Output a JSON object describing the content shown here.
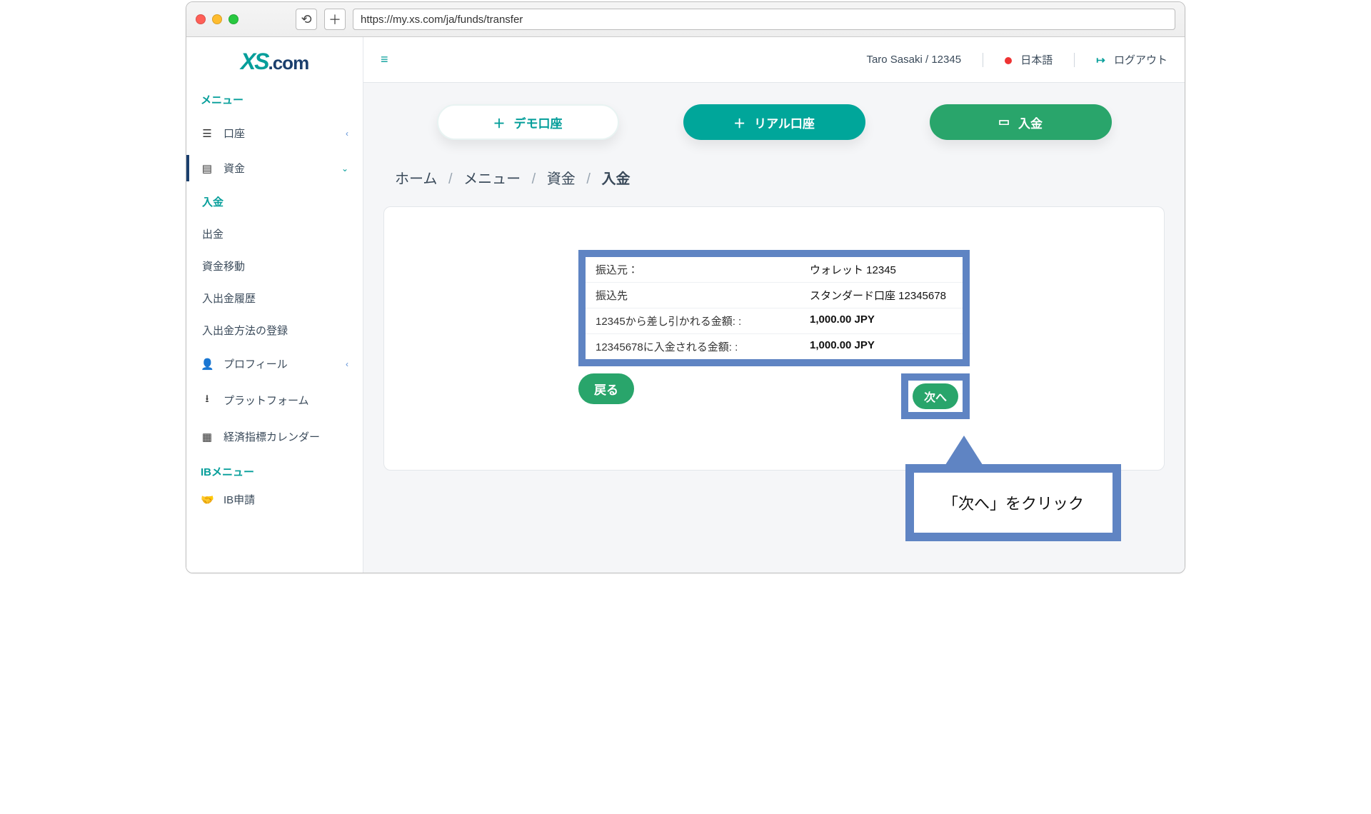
{
  "browser": {
    "url": "https://my.xs.com/ja/funds/transfer"
  },
  "logo": {
    "xs": "XS",
    "com": ".com"
  },
  "sidebar": {
    "menu_title": "メニュー",
    "items": [
      {
        "icon": "list-icon",
        "label": "口座",
        "expandable": true
      },
      {
        "icon": "wallet-icon",
        "label": "資金",
        "expandable": true,
        "active": true
      }
    ],
    "funds_sub": [
      {
        "label": "入金",
        "selected": true
      },
      {
        "label": "出金"
      },
      {
        "label": "資金移動"
      },
      {
        "label": "入出金履歴"
      },
      {
        "label": "入出金方法の登録"
      }
    ],
    "lower": [
      {
        "icon": "user-icon",
        "label": "プロフィール",
        "expandable": true
      },
      {
        "icon": "download-icon",
        "label": "プラットフォーム"
      },
      {
        "icon": "calendar-icon",
        "label": "経済指標カレンダー"
      }
    ],
    "ib_title": "IBメニュー",
    "ib_items": [
      {
        "icon": "handshake-icon",
        "label": "IB申請"
      }
    ]
  },
  "topbar": {
    "user": "Taro Sasaki / 12345",
    "lang": "日本語",
    "logout": "ログアウト"
  },
  "actions": {
    "demo": "デモ口座",
    "real": "リアル口座",
    "deposit": "入金"
  },
  "breadcrumb": {
    "items": [
      "ホーム",
      "メニュー",
      "資金"
    ],
    "current": "入金"
  },
  "transfer": {
    "rows": [
      {
        "k": "振込元：",
        "v": "ウォレット 12345"
      },
      {
        "k": "振込先",
        "v": "スタンダード口座 12345678"
      },
      {
        "k": "12345から差し引かれる金額: :",
        "v": "1,000.00 JPY",
        "bold": true
      },
      {
        "k": "12345678に入金される金額: :",
        "v": "1,000.00 JPY",
        "bold": true
      }
    ],
    "back": "戻る",
    "next": "次へ"
  },
  "callout": "「次へ」をクリック"
}
